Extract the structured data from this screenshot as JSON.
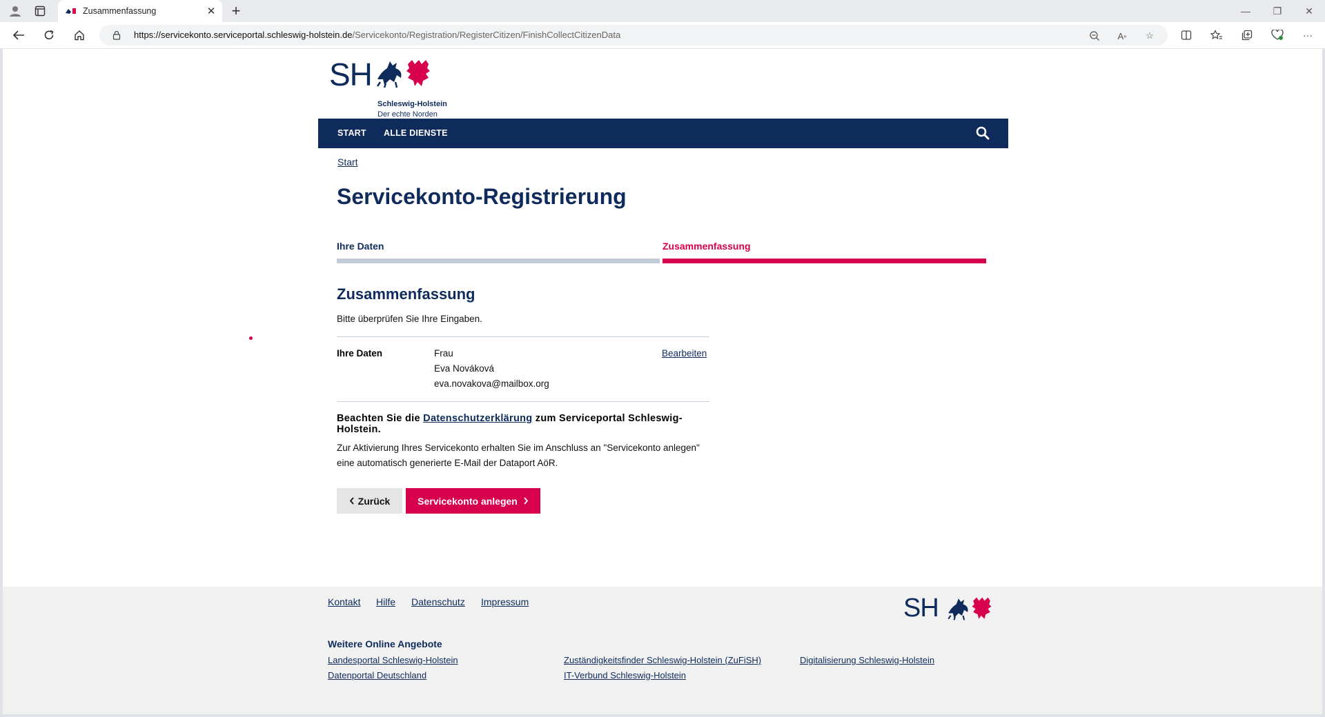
{
  "browser": {
    "tab_title": "Zusammenfassung",
    "url_host": "https://servicekonto.serviceportal.schleswig-holstein.de",
    "url_path": "/Servicekonto/Registration/RegisterCitizen/FinishCollectCitizenData"
  },
  "logo": {
    "mark": "SH",
    "line1": "Schleswig-Holstein",
    "line2": "Der echte Norden"
  },
  "nav": {
    "start": "START",
    "all_services": "ALLE DIENSTE"
  },
  "breadcrumb": "Start",
  "page_title": "Servicekonto-Registrierung",
  "steps": [
    {
      "label": "Ihre Daten",
      "state": "done",
      "color": "#0e2b5c",
      "bar_color": "#c2ccd9"
    },
    {
      "label": "Zusammenfassung",
      "state": "active",
      "color": "#d6004c",
      "bar_color": "#d6004c"
    }
  ],
  "summary": {
    "heading": "Zusammenfassung",
    "hint": "Bitte überprüfen Sie Ihre Eingaben.",
    "section_label": "Ihre Daten",
    "salutation": "Frau",
    "name": "Eva Nováková",
    "email": "eva.novakova@mailbox.org",
    "edit_label": "Bearbeiten"
  },
  "notice": {
    "pre": "Beachten Sie die ",
    "link": "Datenschutzerklärung",
    "post": " zum Serviceportal Schleswig-Holstein.",
    "paragraph": "Zur Aktivierung Ihres Servicekonto erhalten Sie im Anschluss an \"Servicekonto anlegen\" eine automatisch generierte E-Mail der Dataport AöR."
  },
  "buttons": {
    "back": "Zurück",
    "create": "Servicekonto anlegen"
  },
  "footer": {
    "links": [
      "Kontakt",
      "Hilfe",
      "Datenschutz",
      "Impressum"
    ],
    "more_heading": "Weitere Online Angebote",
    "more_links": [
      "Landesportal Schleswig-Holstein",
      "Zuständigkeitsfinder Schleswig-Holstein (ZuFiSH)",
      "Digitalisierung Schleswig-Holstein",
      "Datenportal Deutschland",
      "IT-Verbund Schleswig-Holstein"
    ]
  },
  "colors": {
    "brand_blue": "#0e2b5c",
    "brand_red": "#d6004c"
  }
}
